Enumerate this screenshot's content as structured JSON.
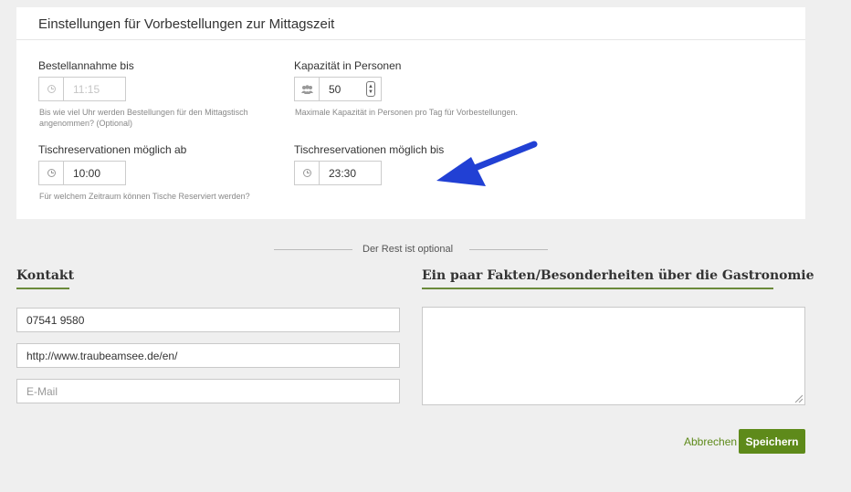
{
  "settings": {
    "title": "Einstellungen für Vorbestellungen zur Mittagszeit",
    "order_until": {
      "label": "Bestellannahme bis",
      "value": "11:15",
      "help": "Bis wie viel Uhr werden Bestellungen für den Mittagstisch angenommen? (Optional)",
      "icon": "clock-icon"
    },
    "capacity": {
      "label": "Kapazität in Personen",
      "value": "50",
      "help": "Maximale Kapazität in Personen pro Tag für Vorbestellungen.",
      "icon": "users-icon"
    },
    "reservation_from": {
      "label": "Tischreservationen möglich ab",
      "value": "10:00",
      "help": "Für welchem Zeitraum können Tische Reserviert werden?",
      "icon": "clock-icon"
    },
    "reservation_until": {
      "label": "Tischreservationen möglich bis",
      "value": "23:30",
      "icon": "clock-icon"
    }
  },
  "separator": {
    "text": "Der Rest ist optional"
  },
  "contact": {
    "title": "Kontakt",
    "phone": "07541 9580",
    "website": "http://www.traubeamsee.de/en/",
    "email_placeholder": "E-Mail"
  },
  "facts": {
    "title": "Ein paar Fakten/Besonderheiten über die Gastronomie",
    "value": ""
  },
  "actions": {
    "cancel_label": "Abbrechen",
    "save_label": "Speichern"
  },
  "colors": {
    "accent": "#5e8a1a",
    "annotation_arrow": "#2140d4"
  }
}
